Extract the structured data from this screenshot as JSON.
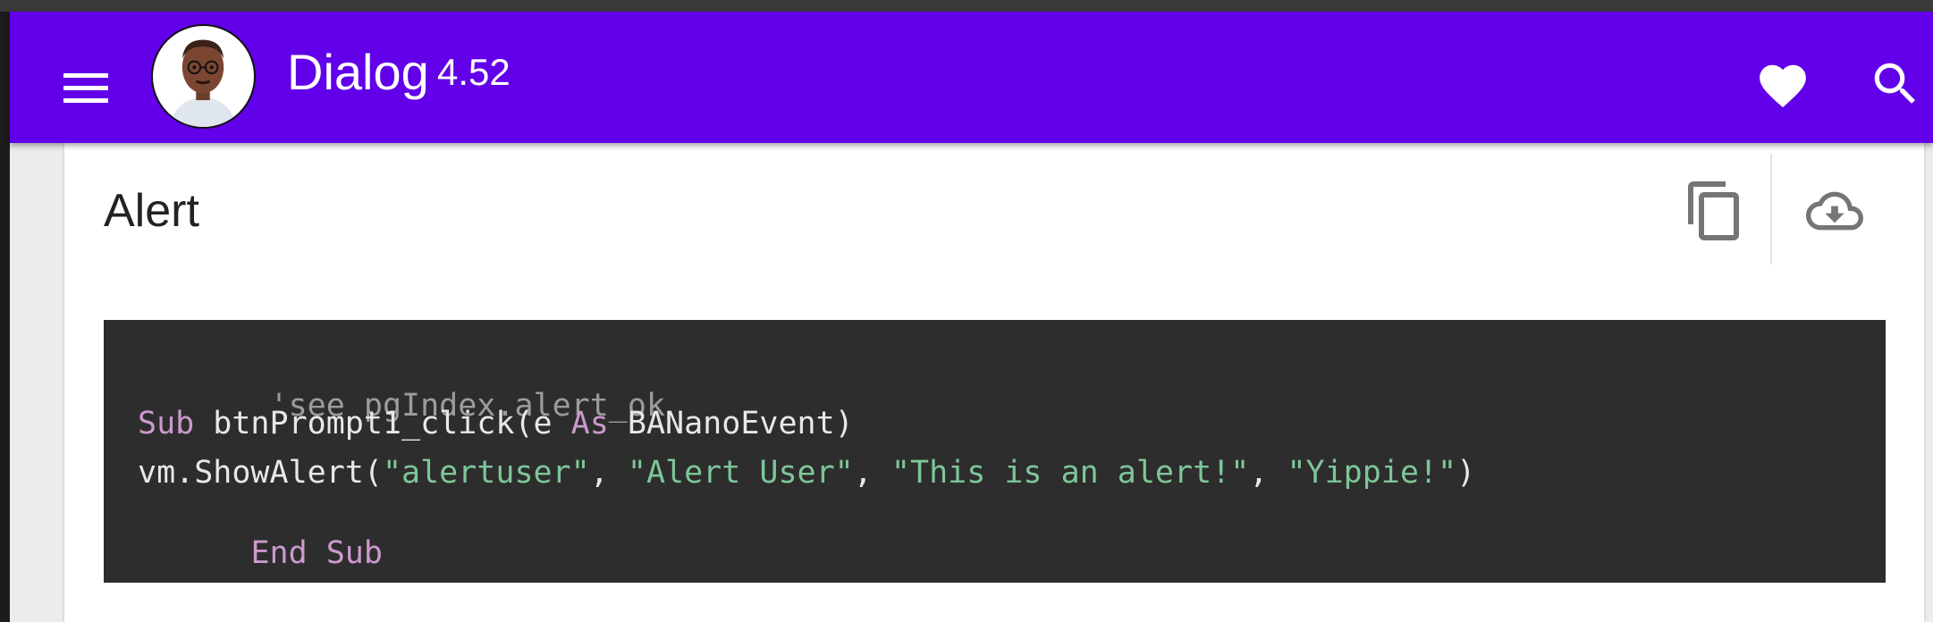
{
  "colors": {
    "appbar": "#6200ea",
    "code_background": "#2d2d2d",
    "code_keyword": "#cc99cd",
    "code_string": "#7ec699",
    "code_comment": "#9c9c9c",
    "code_text": "#e8e8e8"
  },
  "appbar": {
    "menu_icon": "hamburger-menu-icon",
    "avatar": "cartoon-man-avatar",
    "title": "Dialog",
    "version": "4.52",
    "actions": [
      "heart-icon",
      "search-icon"
    ]
  },
  "card": {
    "title": "Alert",
    "actions": [
      "copy-icon",
      "cloud-download-icon"
    ]
  },
  "code": {
    "line1": {
      "comment": " 'see pgIndex.alert_ok"
    },
    "line2": {
      "kw_sub": "Sub",
      "text_a": " btnPrompt1_click(e ",
      "kw_as": "As",
      "text_b": " BANanoEvent)"
    },
    "line3": {
      "text_a": "vm.ShowAlert(",
      "str1": "\"alertuser\"",
      "sep1": ", ",
      "str2": "\"Alert User\"",
      "sep2": ", ",
      "str3": "\"This is an alert!\"",
      "sep3": ", ",
      "str4": "\"Yippie!\"",
      "text_b": ")"
    },
    "line4": {
      "kw_end_sub": "End Sub"
    }
  }
}
